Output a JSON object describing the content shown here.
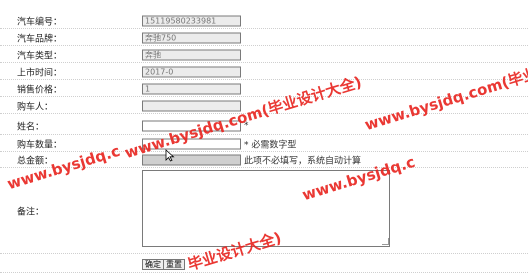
{
  "form": {
    "car_id": {
      "label": "汽车编号：",
      "value": "15119580233981"
    },
    "brand": {
      "label": "汽车品牌：",
      "value": "奔驰750"
    },
    "type": {
      "label": "汽车类型：",
      "value": "奔驰"
    },
    "launch": {
      "label": "上市时间：",
      "value": "2017-0"
    },
    "price": {
      "label": "销售价格：",
      "value": "1"
    },
    "buyer": {
      "label": "购车人：",
      "value": ""
    },
    "name": {
      "label": "姓名：",
      "value": "",
      "required_mark": "*"
    },
    "quantity": {
      "label": "购车数量：",
      "value": "",
      "required_mark": "*",
      "hint": "必需数字型"
    },
    "total": {
      "label": "总金额：",
      "value": "",
      "hint": "此项不必填写，系统自动计算"
    },
    "remark": {
      "label": "备注：",
      "value": ""
    },
    "buttons": {
      "confirm": "确定",
      "reset": "重置"
    }
  },
  "watermark": {
    "text_long": "www.bysjdq.com(毕业设计大全)",
    "text_mid": "www.bysjdq.com(毕业设计",
    "text_short": "www.bysjdq.c",
    "text_cn": "毕业设计大全)",
    "color": "#e8231e"
  }
}
